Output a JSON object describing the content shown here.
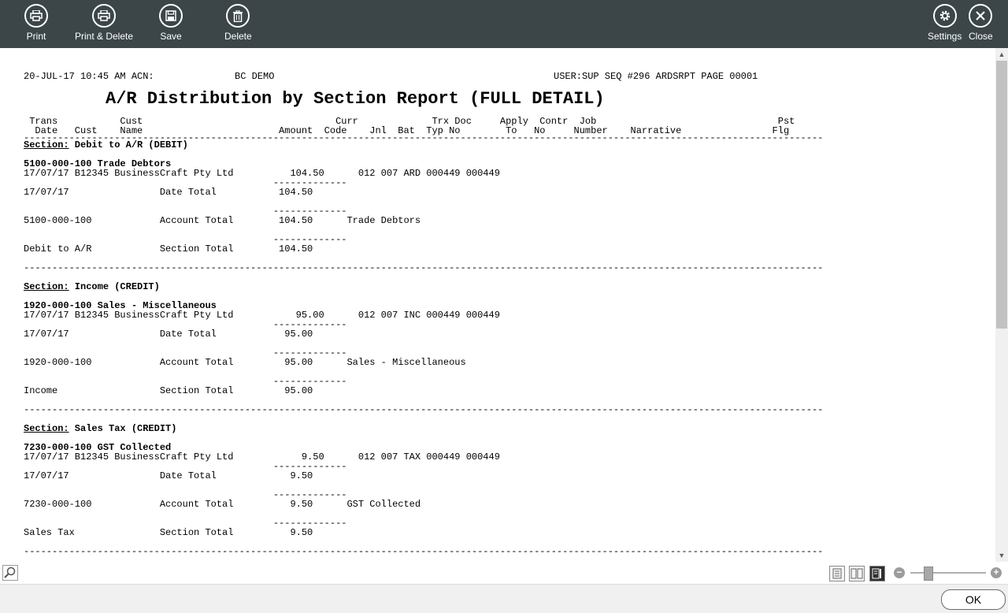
{
  "toolbar": {
    "print": "Print",
    "print_delete": "Print & Delete",
    "save": "Save",
    "delete": "Delete",
    "settings": "Settings",
    "close": "Close"
  },
  "report": {
    "header_left": "20-JUL-17 10:45 AM ACN:",
    "header_company": "BC DEMO",
    "header_right": "USER:SUP SEQ #296 ARDSRPT PAGE 00001",
    "title": "A/R Distribution by Section Report (FULL DETAIL)",
    "col_row1": " Trans           Cust                                  Curr             Trx Doc     Apply  Contr  Job                                Pst",
    "col_row2": "  Date   Cust    Name                        Amount  Code    Jnl  Bat  Typ No        To   No     Number    Narrative                Flg",
    "divider": "---------------------------------------------------------------------------------------------------------------------------------------------",
    "sections": [
      {
        "label": "Section:",
        "name": " Debit to A/R (DEBIT)",
        "account_heading": "5100-000-100 Trade Debtors",
        "detail": "17/07/17 B12345 BusinessCraft Pty Ltd          104.50      012 007 ARD 000449 000449",
        "date_total": "17/07/17                Date Total           104.50",
        "account_total": "5100-000-100            Account Total        104.50      Trade Debtors",
        "section_total": "Debit to A/R            Section Total        104.50"
      },
      {
        "label": "Section:",
        "name": " Income (CREDIT)",
        "account_heading": "1920-000-100 Sales - Miscellaneous",
        "detail": "17/07/17 B12345 BusinessCraft Pty Ltd           95.00      012 007 INC 000449 000449",
        "date_total": "17/07/17                Date Total            95.00",
        "account_total": "1920-000-100            Account Total         95.00      Sales - Miscellaneous",
        "section_total": "Income                  Section Total         95.00"
      },
      {
        "label": "Section:",
        "name": " Sales Tax (CREDIT)",
        "account_heading": "7230-000-100 GST Collected",
        "detail": "17/07/17 B12345 BusinessCraft Pty Ltd            9.50      012 007 TAX 000449 000449",
        "date_total": "17/07/17                Date Total             9.50",
        "account_total": "7230-000-100            Account Total          9.50      GST Collected",
        "section_total": "Sales Tax               Section Total          9.50"
      }
    ],
    "subtotal_rule": "                                            -------------"
  },
  "footer": {
    "ok": "OK"
  }
}
